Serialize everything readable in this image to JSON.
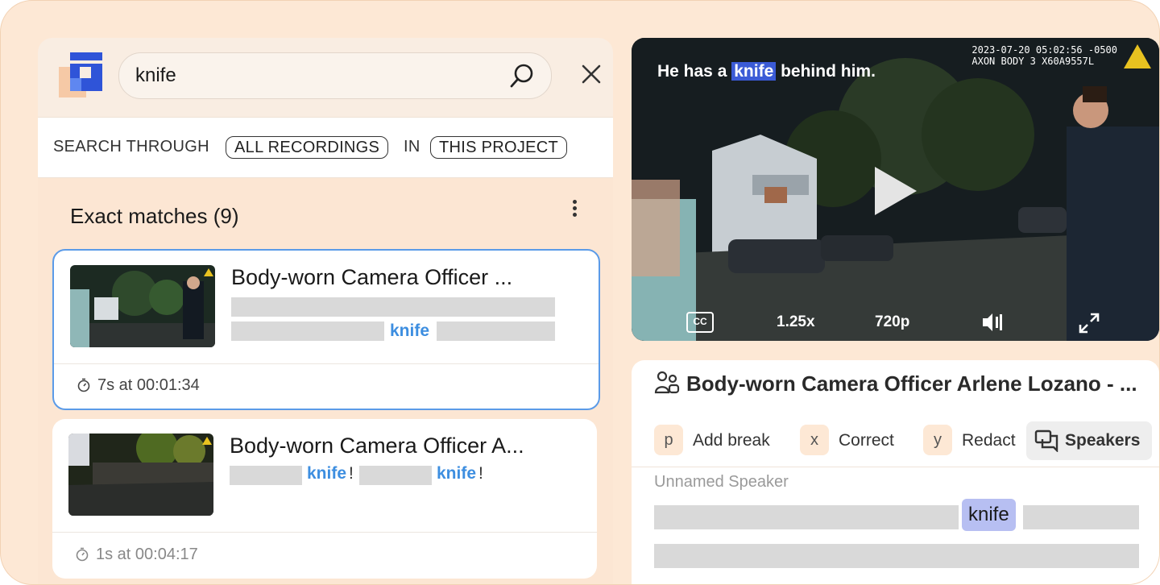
{
  "search": {
    "query": "knife",
    "scope_prefix": "SEARCH THROUGH",
    "scope_recordings": "ALL RECORDINGS",
    "scope_in": "IN",
    "scope_project": "THIS PROJECT"
  },
  "results": {
    "heading": "Exact matches",
    "count": "(9)",
    "items": [
      {
        "title": "Body-worn Camera Officer ...",
        "highlight": "knife",
        "meta": "7s at 00:01:34"
      },
      {
        "title": "Body-worn Camera Officer A...",
        "highlight1": "knife",
        "punct1": "!",
        "highlight2": "knife",
        "punct2": "!",
        "meta": "1s at 00:04:17"
      }
    ]
  },
  "video": {
    "caption_before": "He has a",
    "caption_mark": "knife",
    "caption_after": "behind him.",
    "timestamp": "2023-07-20 05:02:56 -0500",
    "device": "AXON BODY 3 X60A9557L",
    "cc_label": "CC",
    "speed": "1.25x",
    "quality": "720p"
  },
  "transcript": {
    "title": "Body-worn Camera Officer Arlene Lozano - ...",
    "shortcuts": [
      {
        "key": "p",
        "label": "Add break"
      },
      {
        "key": "x",
        "label": "Correct"
      },
      {
        "key": "y",
        "label": "Redact"
      }
    ],
    "speakers_label": "Speakers",
    "speaker_name": "Unnamed Speaker",
    "highlight_word": "knife"
  },
  "icons": {
    "logo": "app-logo",
    "search": "search-icon",
    "close": "close-icon",
    "more": "more-vertical-icon",
    "timer": "stopwatch-icon",
    "play": "play-icon",
    "cc": "closed-captions-icon",
    "volume": "volume-icon",
    "fullscreen": "fullscreen-icon",
    "speakers": "speakers-icon",
    "people": "people-icon"
  },
  "colors": {
    "background": "#fde8d5",
    "accent_blue": "#3d8ee0",
    "active_border": "#5b9be8",
    "caption_highlight": "#3b5bd6",
    "transcript_highlight": "#b7bff2"
  }
}
